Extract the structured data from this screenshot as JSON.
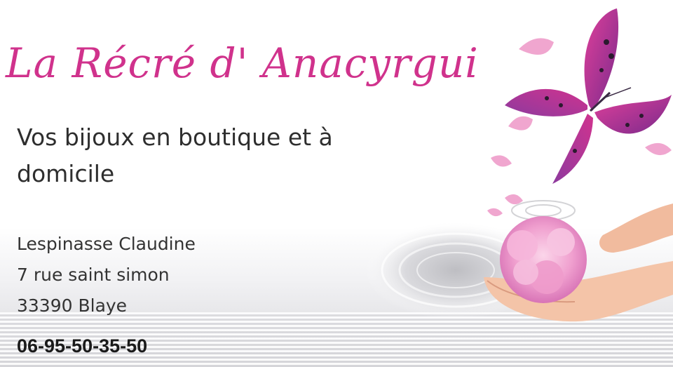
{
  "card": {
    "title": "La Récré d' Anacyrgui",
    "tagline": "Vos bijoux en boutique et à domicile",
    "name": "Lespinasse Claudine",
    "street": "7 rue saint simon",
    "city": "33390 Blaye",
    "phone": "06-95-50-35-50"
  },
  "illustration": {
    "icons": [
      "butterfly-icon",
      "flower-petals-icon",
      "cupped-hands-icon",
      "water-ripple-icon"
    ]
  },
  "colors": {
    "title": "#d0328c",
    "text": "#2e2e2e",
    "butterfly": "#b0308a",
    "flower": "#f2a6d2",
    "skin": "#f4c4a8"
  }
}
